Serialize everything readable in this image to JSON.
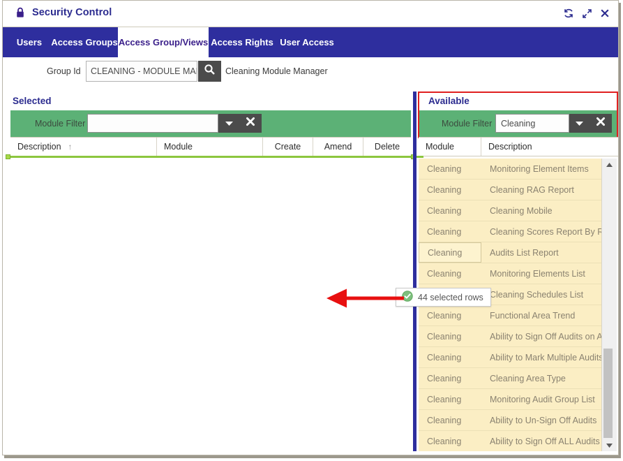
{
  "window": {
    "title": "Security Control",
    "lock_icon": "lock-icon",
    "controls": [
      {
        "name": "refresh-icon",
        "glyph": "↻"
      },
      {
        "name": "expand-icon",
        "glyph": "↗"
      },
      {
        "name": "close-icon",
        "glyph": "✕"
      }
    ]
  },
  "tabs": [
    {
      "label": "Users",
      "active": false
    },
    {
      "label": "Access Groups",
      "active": false
    },
    {
      "label": "Access Group/Views",
      "active": true
    },
    {
      "label": "Access Rights",
      "active": false
    },
    {
      "label": "User Access",
      "active": false
    }
  ],
  "group_id": {
    "label": "Group Id",
    "value": "CLEANING - MODULE MANA",
    "placeholder": "",
    "search_icon": "search-icon",
    "description": "Cleaning Module Manager"
  },
  "selected_panel": {
    "title": "Selected",
    "filter": {
      "label": "Module Filter",
      "value": "",
      "placeholder": "",
      "dropdown_icon": "chevron-down-icon",
      "clear_icon": "clear-x-icon"
    },
    "columns": [
      {
        "label": "Description",
        "sort": "↑"
      },
      {
        "label": "Module",
        "sort": ""
      },
      {
        "label": "Create",
        "sort": ""
      },
      {
        "label": "Amend",
        "sort": ""
      },
      {
        "label": "Delete",
        "sort": ""
      }
    ],
    "rows": []
  },
  "available_panel": {
    "title": "Available",
    "filter": {
      "label": "Module Filter",
      "value": "Cleaning",
      "placeholder": "",
      "dropdown_icon": "chevron-down-icon",
      "clear_icon": "clear-x-icon"
    },
    "columns": [
      {
        "label": "Module"
      },
      {
        "label": "Description"
      }
    ],
    "rows": [
      {
        "module": "Cleaning",
        "description": "Monitoring Element Items",
        "focused": false
      },
      {
        "module": "Cleaning",
        "description": "Cleaning RAG Report",
        "focused": false
      },
      {
        "module": "Cleaning",
        "description": "Cleaning Mobile",
        "focused": false
      },
      {
        "module": "Cleaning",
        "description": "Cleaning Scores Report By Risk",
        "focused": false
      },
      {
        "module": "Cleaning",
        "description": "Audits List Report",
        "focused": true
      },
      {
        "module": "Cleaning",
        "description": "Monitoring Elements List",
        "focused": false
      },
      {
        "module": "Cleaning",
        "description": "Cleaning Schedules List",
        "focused": false
      },
      {
        "module": "Cleaning",
        "description": "Functional Area Trend",
        "focused": false
      },
      {
        "module": "Cleaning",
        "description": "Ability to Sign Off Audits on Au...",
        "focused": false
      },
      {
        "module": "Cleaning",
        "description": "Ability to Mark Multiple Audits ...",
        "focused": false
      },
      {
        "module": "Cleaning",
        "description": "Cleaning Area Type",
        "focused": false
      },
      {
        "module": "Cleaning",
        "description": "Monitoring Audit Group List",
        "focused": false
      },
      {
        "module": "Cleaning",
        "description": "Ability to Un-Sign Off Audits",
        "focused": false
      },
      {
        "module": "Cleaning",
        "description": "Ability to Sign Off ALL Audits o...",
        "focused": false
      }
    ],
    "scrollbar": {
      "up_icon": "scroll-up-arrow-icon",
      "down_icon": "scroll-down-arrow-icon"
    }
  },
  "tooltip": {
    "text": "44 selected rows",
    "status_icon": "check-circle-icon"
  },
  "annotation": {
    "arrow_icon": "left-arrow-annotation"
  },
  "colors": {
    "tab_bar": "#2e2e9e",
    "accent_text": "#2b2b8f",
    "filter_green": "#5cb176",
    "row_yellow": "#fbeec4",
    "highlight_red": "#e02020",
    "success_green": "#6fc06f"
  }
}
